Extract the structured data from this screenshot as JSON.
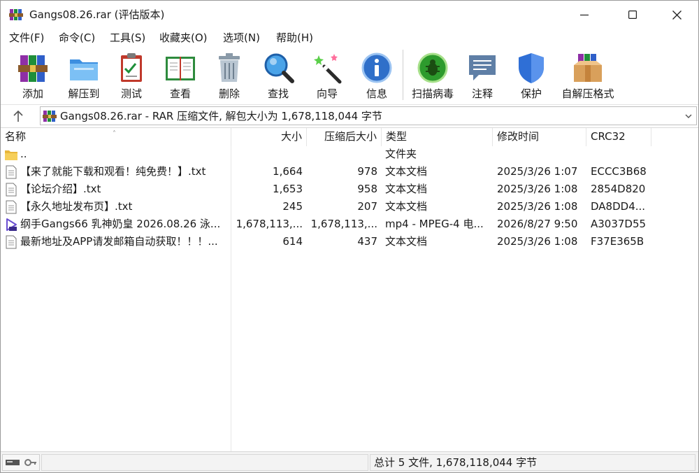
{
  "window": {
    "title": "Gangs08.26.rar (评估版本)"
  },
  "menu": [
    "文件(F)",
    "命令(C)",
    "工具(S)",
    "收藏夹(O)",
    "选项(N)",
    "帮助(H)"
  ],
  "toolbar": [
    {
      "label": "添加",
      "icon": "books-add-icon"
    },
    {
      "label": "解压到",
      "icon": "folder-extract-icon"
    },
    {
      "label": "测试",
      "icon": "clipboard-check-icon"
    },
    {
      "label": "查看",
      "icon": "open-book-icon"
    },
    {
      "label": "删除",
      "icon": "trash-can-icon"
    },
    {
      "label": "查找",
      "icon": "magnifier-icon"
    },
    {
      "label": "向导",
      "icon": "magic-wand-icon"
    },
    {
      "label": "信息",
      "icon": "info-icon"
    },
    {
      "label": "扫描病毒",
      "icon": "bug-scan-icon"
    },
    {
      "label": "注释",
      "icon": "comment-icon"
    },
    {
      "label": "保护",
      "icon": "shield-icon"
    },
    {
      "label": "自解压格式",
      "icon": "sfx-box-icon"
    }
  ],
  "address": {
    "text": "Gangs08.26.rar - RAR 压缩文件, 解包大小为 1,678,118,044 字节"
  },
  "columns": [
    "名称",
    "大小",
    "压缩后大小",
    "类型",
    "修改时间",
    "CRC32"
  ],
  "files": [
    {
      "name": "..",
      "size": "",
      "packed": "",
      "type": "文件夹",
      "modified": "",
      "crc": "",
      "icon": "folder-icon"
    },
    {
      "name": "【来了就能下载和观看！纯免费！】.txt",
      "size": "1,664",
      "packed": "978",
      "type": "文本文档",
      "modified": "2025/3/26 1:07",
      "crc": "ECCC3B68",
      "icon": "text-file-icon"
    },
    {
      "name": "【论坛介绍】.txt",
      "size": "1,653",
      "packed": "958",
      "type": "文本文档",
      "modified": "2025/3/26 1:08",
      "crc": "2854D820",
      "icon": "text-file-icon"
    },
    {
      "name": "【永久地址发布页】.txt",
      "size": "245",
      "packed": "207",
      "type": "文本文档",
      "modified": "2025/3/26 1:08",
      "crc": "DA8DD4...",
      "icon": "text-file-icon"
    },
    {
      "name": "纲手Gangs66 乳神奶皇 2026.08.26 泳...",
      "size": "1,678,113,...",
      "packed": "1,678,113,...",
      "type": "mp4 - MPEG-4 电...",
      "modified": "2026/8/27 9:50",
      "crc": "A3037D55",
      "icon": "video-file-icon"
    },
    {
      "name": "最新地址及APP请发邮箱自动获取！！！...",
      "size": "614",
      "packed": "437",
      "type": "文本文档",
      "modified": "2025/3/26 1:08",
      "crc": "F37E365B",
      "icon": "text-file-icon"
    }
  ],
  "status": {
    "summary": "总计 5 文件, 1,678,118,044 字节"
  }
}
